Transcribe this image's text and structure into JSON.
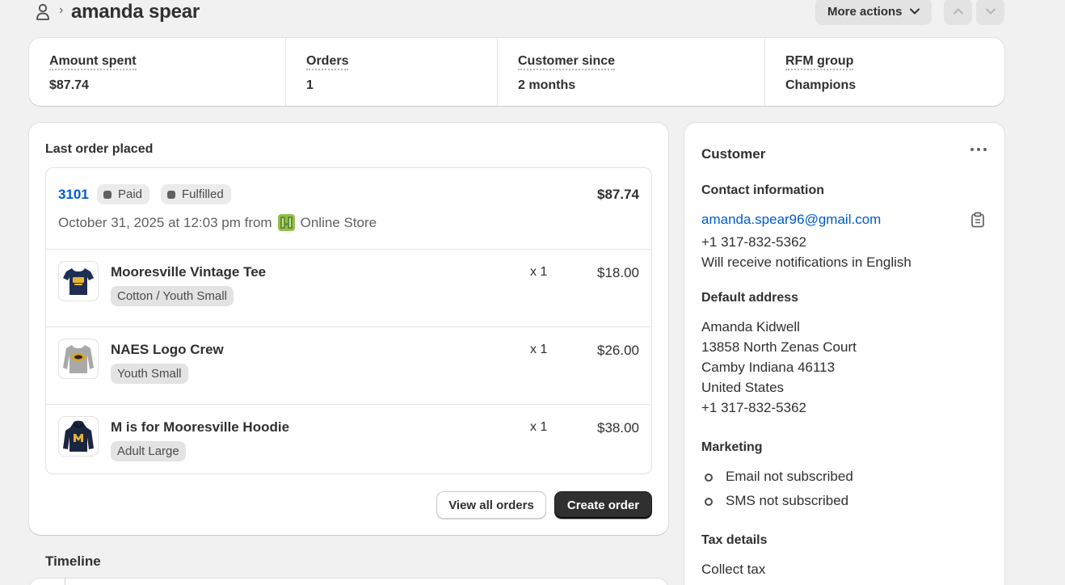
{
  "header": {
    "title": "amanda spear",
    "more_actions_label": "More actions"
  },
  "stats": [
    {
      "label": "Amount spent",
      "value": "$87.74"
    },
    {
      "label": "Orders",
      "value": "1"
    },
    {
      "label": "Customer since",
      "value": "2 months"
    },
    {
      "label": "RFM group",
      "value": "Champions"
    }
  ],
  "last_order": {
    "section_title": "Last order placed",
    "number": "3101",
    "payment_status": "Paid",
    "fulfillment_status": "Fulfilled",
    "total": "$87.74",
    "date_text": "October 31, 2025 at 12:03 pm from",
    "channel": "Online Store",
    "items": [
      {
        "title": "Mooresville Vintage Tee",
        "variant": "Cotton / Youth Small",
        "qty": "x 1",
        "price": "$18.00"
      },
      {
        "title": "NAES Logo Crew",
        "variant": "Youth Small",
        "qty": "x 1",
        "price": "$26.00"
      },
      {
        "title": "M is for Mooresville Hoodie",
        "variant": "Adult Large",
        "qty": "x 1",
        "price": "$38.00"
      }
    ],
    "view_all_label": "View all orders",
    "create_label": "Create order"
  },
  "timeline": {
    "title": "Timeline"
  },
  "customer": {
    "title": "Customer",
    "contact": {
      "title": "Contact information",
      "email": "amanda.spear96@gmail.com",
      "phone": "+1 317-832-5362",
      "language": "Will receive notifications in English"
    },
    "address": {
      "title": "Default address",
      "lines": [
        "Amanda Kidwell",
        "13858 North Zenas Court",
        "Camby Indiana 46113",
        "United States",
        "+1 317-832-5362"
      ]
    },
    "marketing": {
      "title": "Marketing",
      "email_status": "Email not subscribed",
      "sms_status": "SMS not subscribed"
    },
    "tax": {
      "title": "Tax details",
      "value": "Collect tax"
    }
  },
  "colors": {
    "background": "#f1f1f1",
    "link": "#005bd3",
    "primary_button": "#303030"
  },
  "icons": [
    "person-icon",
    "chevron-right-icon",
    "chevron-down-icon",
    "chevron-up-icon",
    "online-store-icon",
    "copy-icon",
    "more-dots-icon"
  ]
}
